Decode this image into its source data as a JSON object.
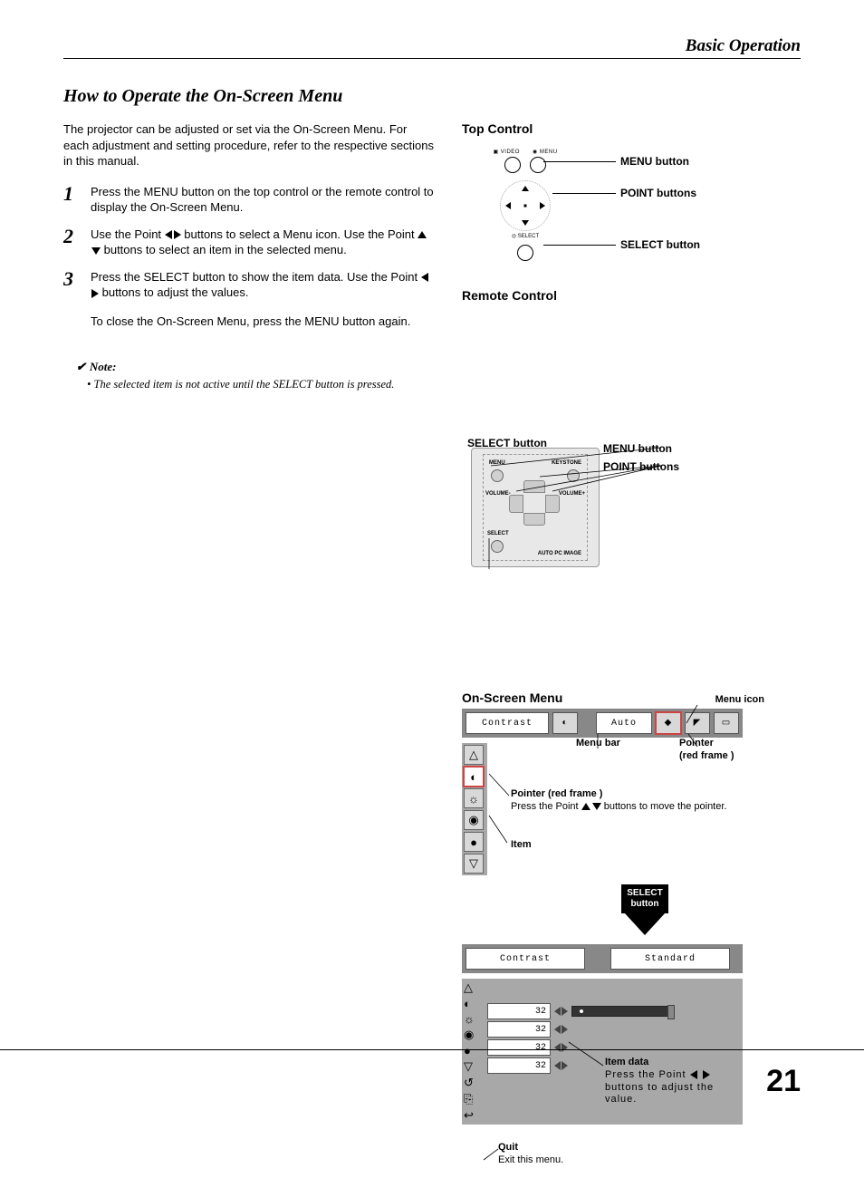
{
  "header": {
    "section": "Basic Operation"
  },
  "title": "How to Operate the On-Screen Menu",
  "intro": "The projector can be adjusted or set via the On-Screen Menu. For each adjustment and setting procedure, refer to the respective sections in this manual.",
  "steps": [
    {
      "num": "1",
      "text": "Press the MENU button on the top control or the remote control to display the On-Screen Menu."
    },
    {
      "num": "2",
      "text_before": "Use the Point ",
      "text_mid": " buttons to select a Menu icon. Use the Point ",
      "text_after": " buttons to select an item in the selected menu."
    },
    {
      "num": "3",
      "text_before": "Press the SELECT button to show the item data. Use the Point ",
      "text_after": " buttons to adjust the values."
    }
  ],
  "close": "To close the On-Screen Menu, press the MENU button again.",
  "note": {
    "label": "Note:",
    "text": "• The selected item is not active until the SELECT button is pressed."
  },
  "top_control": {
    "caption": "Top Control",
    "labels": {
      "menu": "MENU button",
      "point": "POINT buttons",
      "select": "SELECT button"
    },
    "btn_video": "VIDEO",
    "btn_menu": "MENU",
    "btn_select": "SELECT"
  },
  "remote": {
    "caption": "Remote Control",
    "labels": {
      "menu": "MENU button",
      "point": "POINT buttons",
      "select": "SELECT button"
    },
    "panel": {
      "menu": "MENU",
      "keystone": "KEYSTONE",
      "volm": "VOLUME-",
      "volp": "VOLUME+",
      "select": "SELECT",
      "autopc": "AUTO PC IMAGE"
    }
  },
  "osm": {
    "caption": "On-Screen Menu",
    "menu_icon_label": "Menu icon",
    "menubar_label": "Menu bar",
    "pointer_label": "Pointer\n(red frame )",
    "pointer2_title": "Pointer (red frame )",
    "pointer2_text_before": "Press the Point ",
    "pointer2_text_after": " buttons to move the pointer.",
    "item_label": "Item",
    "select_btn": "SELECT\nbutton",
    "bar1": {
      "contrast": "Contrast",
      "auto": "Auto"
    },
    "bar2": {
      "contrast": "Contrast",
      "standard": "Standard"
    },
    "values": [
      "32",
      "32",
      "32",
      "32"
    ],
    "item_data_title": "Item data",
    "item_data_text_before": "Press the Point ",
    "item_data_text_after": " buttons to adjust the value.",
    "quit_title": "Quit",
    "quit_text": "Exit this menu."
  },
  "page_number": "21"
}
